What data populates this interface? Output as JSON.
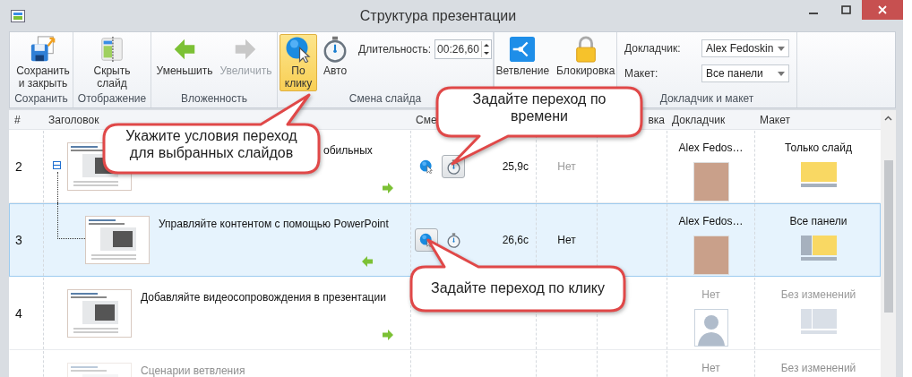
{
  "window": {
    "title": "Структура презентации"
  },
  "ribbon": {
    "save": {
      "group_label": "Сохранить",
      "save_close_button": "Сохранить и закрыть"
    },
    "display": {
      "group_label": "Отображение",
      "hide_slide_button": "Скрыть слайд"
    },
    "nesting": {
      "group_label": "Вложенность",
      "decrease_button": {
        "label": "Уменьшить",
        "disabled": false
      },
      "increase_button": {
        "label": "Увеличить",
        "disabled": true
      }
    },
    "slide_change": {
      "group_label": "Смена слайда",
      "options": [
        {
          "label": "По клику",
          "selected": true
        },
        {
          "label": "Авто",
          "selected": false
        }
      ],
      "duration": {
        "label": "Длительность:",
        "value": "00:26,60"
      }
    },
    "branching": {
      "branch_button": "Ветвление",
      "lock_button": "Блокировка"
    },
    "presenter_layout": {
      "group_label": "Докладчик и макет",
      "presenter": {
        "label": "Докладчик:",
        "value": "Alex Fedoskin"
      },
      "layout": {
        "label": "Макет:",
        "value": "Все панели"
      }
    }
  },
  "table": {
    "header": {
      "number": "#",
      "title": "Заголовок",
      "change": "Сме",
      "column_5": "вка",
      "presenter": "Докладчик",
      "layout": "Макет"
    },
    "rows": [
      {
        "number": "2",
        "title_tail": "обильных",
        "expanded": true,
        "click_button": {
          "selected": false
        },
        "timer_button": {
          "selected": true
        },
        "duration": "25,9с",
        "branch": "Нет",
        "speaker": {
          "name": "Alex Fedos…",
          "kind": "photo"
        },
        "layout": {
          "label": "Только слайд",
          "kind": "slide_only"
        },
        "arrow": {
          "kind": "right"
        },
        "selected": false,
        "children": [
          {
            "number": "3",
            "title": "Управляйте контентом с помощью PowerPoint",
            "click_button": {
              "selected": true
            },
            "timer_button": {
              "selected": false
            },
            "duration": "26,6с",
            "branch": "Нет",
            "speaker": {
              "name": "Alex Fedos…",
              "kind": "photo"
            },
            "layout": {
              "label": "Все панели",
              "kind": "all_panels"
            },
            "arrow": {
              "kind": "left"
            },
            "selected": true
          }
        ]
      },
      {
        "number": "4",
        "title": "Добавляйте видеосопровождения в презентации",
        "speaker": {
          "name": "Нет",
          "kind": "none"
        },
        "layout": {
          "label": "Без изменений",
          "kind": "none"
        },
        "arrow": {
          "kind": "right"
        },
        "selected": false
      },
      {
        "title": "Сценарии ветвления",
        "speaker": {
          "name": "Нет",
          "kind": "none"
        },
        "layout": {
          "label": "Без изменений",
          "kind": "none"
        },
        "selected": false
      }
    ]
  },
  "callouts": [
    {
      "text": "Укажите условия переход для выбранных слайдов"
    },
    {
      "text": "Задайте переход по времени"
    },
    {
      "text": "Задайте переход по клику"
    }
  ]
}
